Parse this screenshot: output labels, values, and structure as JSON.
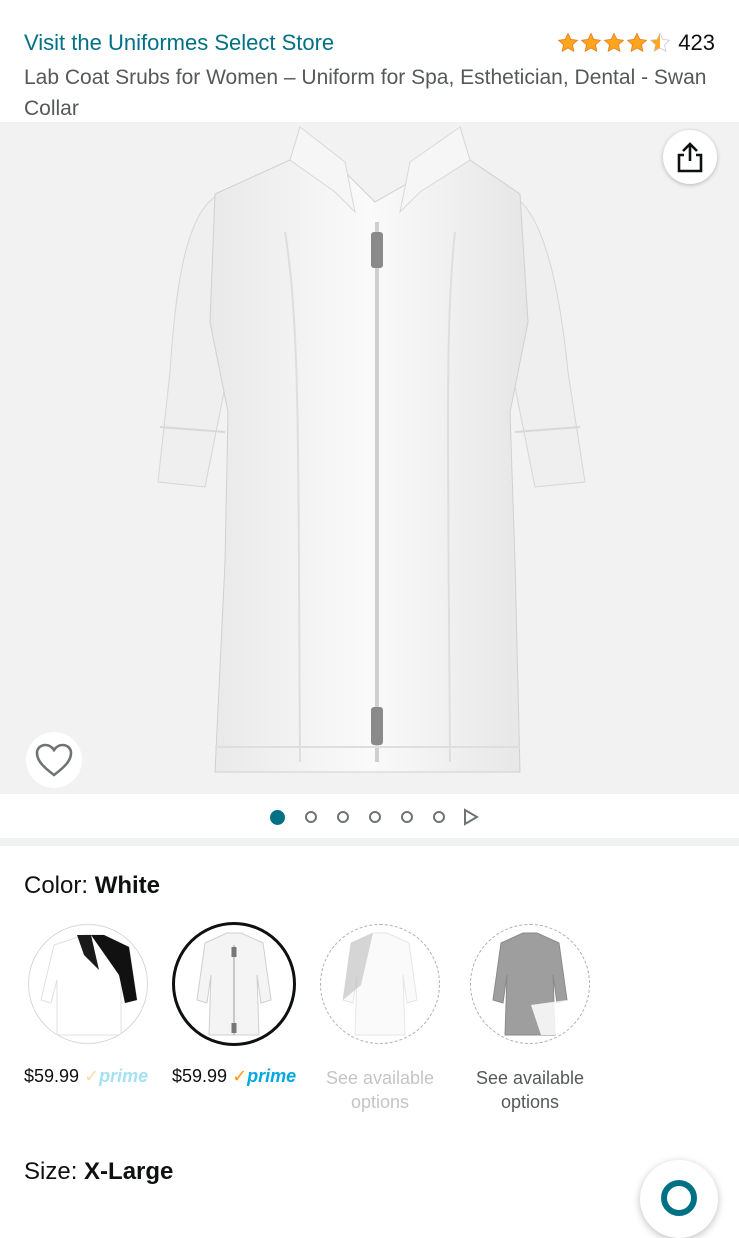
{
  "header": {
    "store_link": "Visit the Uniformes Select Store",
    "rating_value": 4.5,
    "rating_count": "423",
    "product_title": "Lab Coat Srubs for Women – Uniform for Spa, Esthetician, Dental - Swan Collar"
  },
  "gallery": {
    "image_count": 6,
    "active_index": 0,
    "share_icon": "share-icon",
    "wishlist_icon": "heart-icon"
  },
  "color": {
    "label": "Color:",
    "selected": "White"
  },
  "swatches": [
    {
      "price": "$59.99",
      "prime": "prime",
      "variant": "white-black"
    },
    {
      "price": "$59.99",
      "prime": "prime",
      "variant": "white",
      "selected": true
    },
    {
      "unavailable": "See available options",
      "variant": "white-light"
    },
    {
      "unavailable": "See available options",
      "variant": "grey"
    }
  ],
  "size": {
    "label": "Size:",
    "selected": "X-Large"
  },
  "colors": {
    "link": "#007185",
    "star": "#ffa41c",
    "prime": "#00a8e1"
  }
}
